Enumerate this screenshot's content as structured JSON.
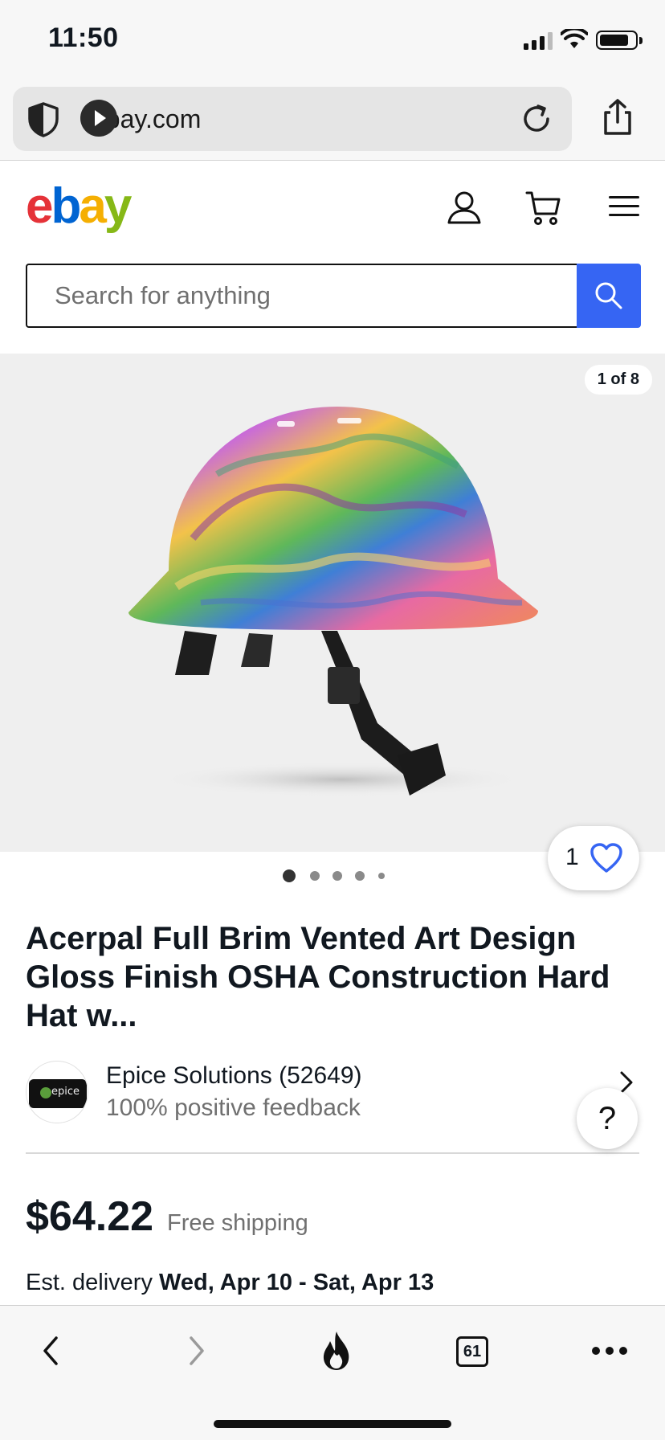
{
  "status_bar": {
    "time": "11:50"
  },
  "browser": {
    "url": "ebay.com",
    "tab_count": "61"
  },
  "header": {
    "logo": {
      "e": "e",
      "b": "b",
      "a": "a",
      "y": "y"
    },
    "search_placeholder": "Search for anything"
  },
  "gallery": {
    "counter": "1 of 8",
    "watch_count": "1",
    "dots_total": 5,
    "active_dot": 1
  },
  "listing": {
    "title": "Acerpal Full Brim Vented Art Design Gloss Finish OSHA Construction Hard Hat w...",
    "seller_name": "Epice Solutions (52649)",
    "seller_feedback": "100% positive feedback",
    "seller_logo_text": "epice",
    "price": "$64.22",
    "shipping": "Free shipping",
    "delivery_label": "Est. delivery",
    "delivery_dates": "Wed, Apr 10 - Sat, Apr 13"
  },
  "help": {
    "label": "?"
  },
  "colors": {
    "search_button": "#3665f3",
    "watch_heart": "#3665f3",
    "ebay_red": "#e53238",
    "ebay_blue": "#0064d2",
    "ebay_yellow": "#f5af02",
    "ebay_green": "#86b817"
  },
  "icons": [
    "shield-icon",
    "reload-icon",
    "share-icon",
    "user-icon",
    "cart-icon",
    "menu-icon",
    "search-icon",
    "heart-icon",
    "chevron-right-icon",
    "back-icon",
    "forward-icon",
    "fire-icon",
    "tabs-icon",
    "more-icon"
  ]
}
